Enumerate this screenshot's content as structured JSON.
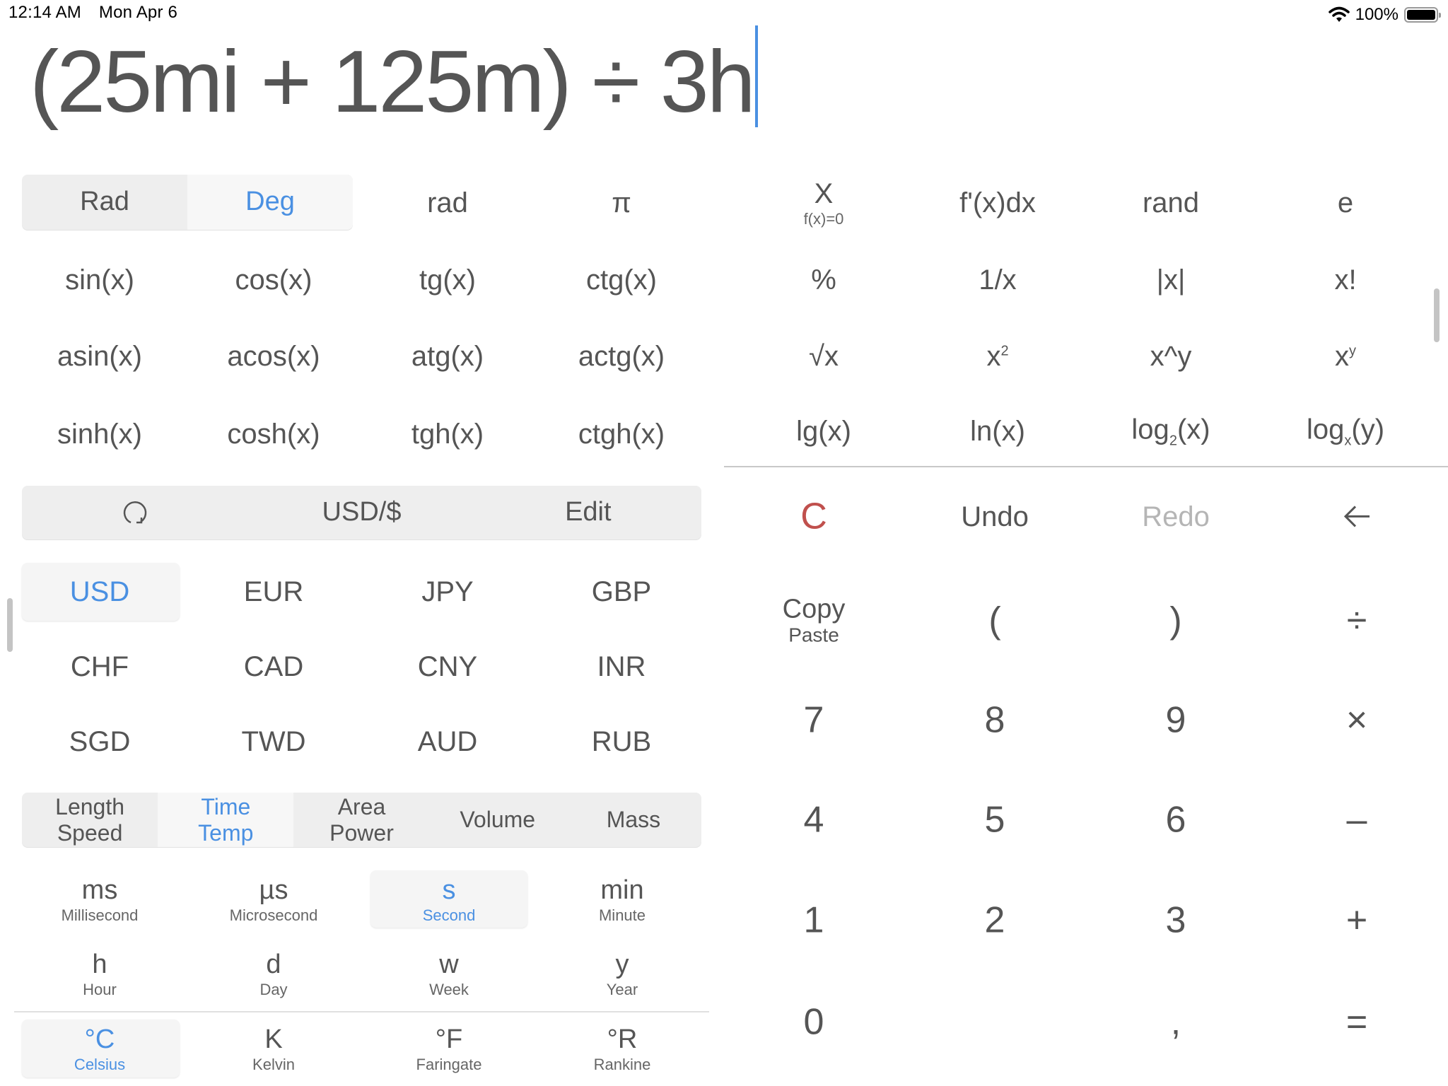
{
  "status_bar": {
    "time": "12:14 AM",
    "date": "Mon Apr 6",
    "wifi_icon": "wifi-icon",
    "battery_percent": "100%",
    "battery_level": 1.0
  },
  "expression": {
    "text": "(25mi + 125m) ÷ 3h"
  },
  "angle_mode": {
    "options": [
      "Rad",
      "Deg"
    ],
    "selected": "Deg"
  },
  "constants_row": [
    "rad",
    "π"
  ],
  "trig_functions": [
    [
      "sin(x)",
      "cos(x)",
      "tg(x)",
      "ctg(x)"
    ],
    [
      "asin(x)",
      "acos(x)",
      "atg(x)",
      "actg(x)"
    ],
    [
      "sinh(x)",
      "cosh(x)",
      "tgh(x)",
      "ctgh(x)"
    ]
  ],
  "advanced_functions": {
    "solve": {
      "label": "X",
      "sublabel": "f(x)=0"
    },
    "row1": [
      "f'(x)dx",
      "rand",
      "e"
    ],
    "row2": [
      "%",
      "1/x",
      "|x|",
      "x!"
    ],
    "row3": {
      "sqrt": "√x",
      "square_base": "x",
      "square_exp": "2",
      "power_caret": "x^y",
      "power_base": "x",
      "power_exp": "y"
    },
    "row4": {
      "lg": "lg(x)",
      "ln": "ln(x)",
      "log2_pre": "log",
      "log2_sub": "2",
      "log2_post": "(x)",
      "logx_pre": "log",
      "logx_sub": "x",
      "logx_post": "(y)"
    }
  },
  "currency_toolbar": {
    "refresh_icon": "refresh-icon",
    "base": "USD/$",
    "edit": "Edit"
  },
  "currencies": {
    "selected": "USD",
    "rows": [
      [
        "USD",
        "EUR",
        "JPY",
        "GBP"
      ],
      [
        "CHF",
        "CAD",
        "CNY",
        "INR"
      ],
      [
        "SGD",
        "TWD",
        "AUD",
        "RUB"
      ]
    ]
  },
  "unit_categories": [
    {
      "line1": "Length",
      "line2": "Speed"
    },
    {
      "line1": "Time",
      "line2": "Temp",
      "active": true
    },
    {
      "line1": "Area",
      "line2": "Power"
    },
    {
      "line1": "Volume",
      "line2": ""
    },
    {
      "line1": "Mass",
      "line2": ""
    }
  ],
  "time_units": [
    [
      {
        "sym": "ms",
        "name": "Millisecond"
      },
      {
        "sym": "µs",
        "name": "Microsecond"
      },
      {
        "sym": "s",
        "name": "Second",
        "selected": true
      },
      {
        "sym": "min",
        "name": "Minute"
      }
    ],
    [
      {
        "sym": "h",
        "name": "Hour"
      },
      {
        "sym": "d",
        "name": "Day"
      },
      {
        "sym": "w",
        "name": "Week"
      },
      {
        "sym": "y",
        "name": "Year"
      }
    ]
  ],
  "temp_units": [
    {
      "sym": "°C",
      "name": "Celsius",
      "selected": true
    },
    {
      "sym": "K",
      "name": "Kelvin"
    },
    {
      "sym": "°F",
      "name": "Faringate"
    },
    {
      "sym": "°R",
      "name": "Rankine"
    }
  ],
  "keypad": {
    "clear": "C",
    "undo": "Undo",
    "redo": "Redo",
    "backspace": "←",
    "copy": "Copy",
    "paste": "Paste",
    "open_paren": "(",
    "close_paren": ")",
    "divide": "÷",
    "digits": {
      "7": "7",
      "8": "8",
      "9": "9",
      "4": "4",
      "5": "5",
      "6": "6",
      "1": "1",
      "2": "2",
      "3": "3",
      "0": "0"
    },
    "multiply": "×",
    "minus": "–",
    "plus": "+",
    "decimal": ",",
    "equals": "=",
    "colors": {
      "clear": "#c0504d",
      "redo_disabled": "#b5b5b5"
    }
  },
  "accent_color": "#4a90e2"
}
